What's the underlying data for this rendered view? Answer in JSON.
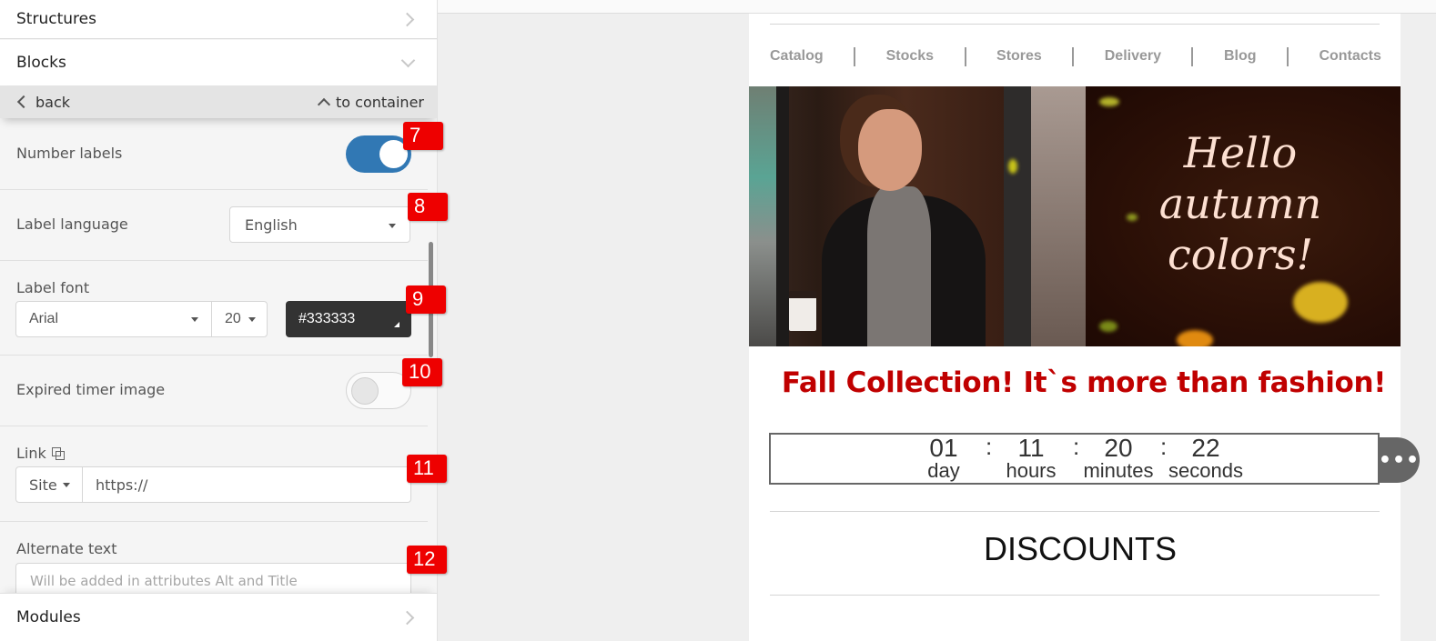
{
  "panel": {
    "sections": {
      "structures": "Structures",
      "blocks": "Blocks",
      "modules": "Modules"
    },
    "nav": {
      "back": "back",
      "to_container": "to container"
    },
    "settings": {
      "number_labels": {
        "label": "Number labels",
        "enabled": true
      },
      "label_language": {
        "label": "Label language",
        "value": "English"
      },
      "label_font": {
        "label": "Label font",
        "family": "Arial",
        "size": "20",
        "color": "#333333"
      },
      "expired_timer_image": {
        "label": "Expired timer image",
        "enabled": false
      },
      "link": {
        "label": "Link",
        "type": "Site",
        "value": "https://"
      },
      "alternate_text": {
        "label": "Alternate text",
        "placeholder": "Will be added in attributes Alt and Title"
      }
    },
    "badges": [
      "7",
      "8",
      "9",
      "10",
      "11",
      "12"
    ]
  },
  "email": {
    "menu": [
      "Catalog",
      "Stocks",
      "Stores",
      "Delivery",
      "Blog",
      "Contacts"
    ],
    "banner": {
      "line1": "Hello",
      "line2": "autumn",
      "line3": "colors!"
    },
    "headline": "Fall Collection! It`s more than fashion!",
    "timer": {
      "units": [
        {
          "value": "01",
          "label": "day"
        },
        {
          "value": "11",
          "label": "hours"
        },
        {
          "value": "20",
          "label": "minutes"
        },
        {
          "value": "22",
          "label": "seconds"
        }
      ],
      "separator": ":"
    },
    "more_button": "•••",
    "discounts": "DISCOUNTS"
  },
  "colors": {
    "accent_toggle": "#3178b4",
    "badge": "#ee0000",
    "headline": "#c00000",
    "label_color": "#333333"
  }
}
